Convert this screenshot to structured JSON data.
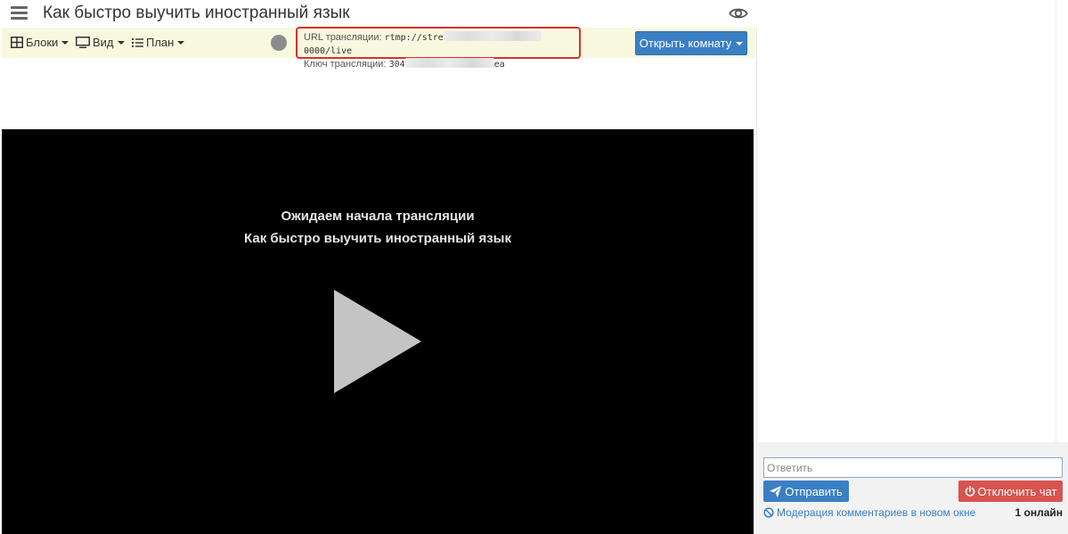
{
  "header": {
    "title": "Как быстро выучить иностранный язык"
  },
  "toolbar": {
    "blocks_label": "Блоки",
    "view_label": "Вид",
    "plan_label": "План"
  },
  "stream_info": {
    "url_label": "URL трансляции:",
    "url_value_start": "rtmp://stre",
    "url_value_end": "0000/live",
    "key_label": "Ключ трансляции:",
    "key_value_start": "304",
    "key_value_end": "ea"
  },
  "open_room": {
    "label": "Открыть комнату"
  },
  "player": {
    "waiting_text": "Ожидаем начала трансляции",
    "stream_title": "Как быстро выучить иностранный язык"
  },
  "chat": {
    "reply_placeholder": "Ответить",
    "send_label": "Отправить",
    "disable_label": "Отключить чат",
    "moderation_label": "Модерация комментариев в новом окне",
    "online_count": "1 онлайн"
  },
  "colors": {
    "primary": "#3a7fc4",
    "danger": "#d9534f",
    "toolbar_bg": "#f8f8df",
    "highlight_border": "#d9312a"
  }
}
